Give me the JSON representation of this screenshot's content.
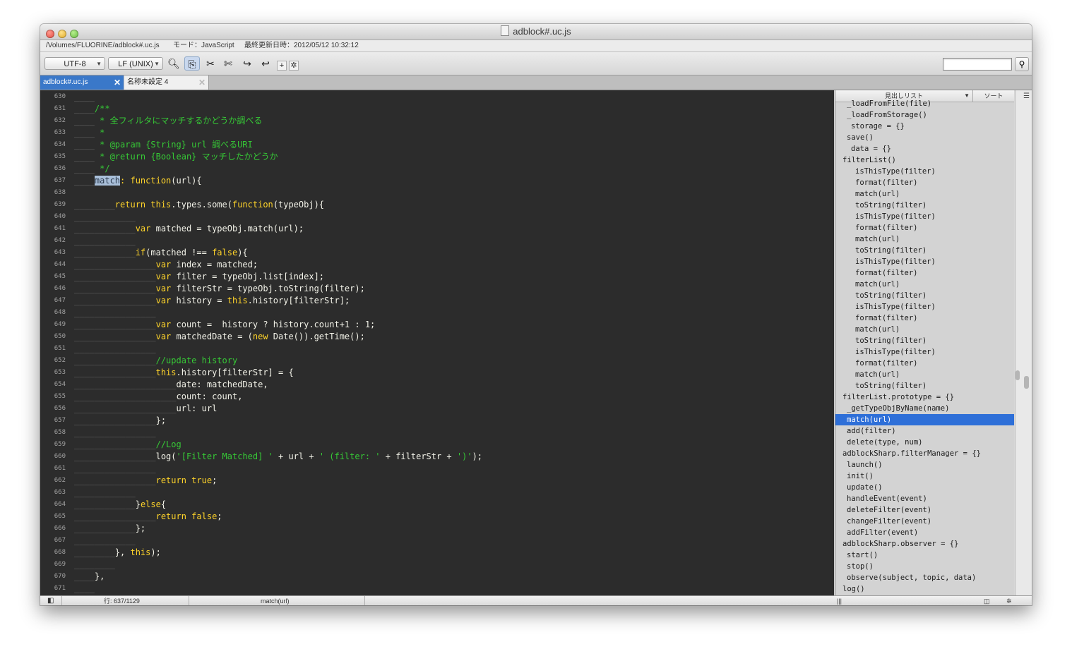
{
  "window": {
    "title": "adblock#.uc.js"
  },
  "info": {
    "path": "/Volumes/FLUORINE/adblock#.uc.js",
    "mode": "モード：JavaScript",
    "modified": "最終更新日時：2012/05/12 10:32:12"
  },
  "toolbar": {
    "encoding": "UTF-8",
    "line_ending": "LF (UNIX)"
  },
  "tabs": [
    {
      "label": "adblock#.uc.js",
      "active": true
    },
    {
      "label": "名称未設定 4",
      "active": false
    }
  ],
  "editor": {
    "lines": [
      {
        "n": "630",
        "i": 1,
        "tokens": []
      },
      {
        "n": "631",
        "i": 1,
        "tokens": [
          [
            "cm",
            "/**"
          ]
        ]
      },
      {
        "n": "632",
        "i": 1,
        "tokens": [
          [
            "cm",
            " * 全フィルタにマッチするかどうか調べる"
          ]
        ]
      },
      {
        "n": "633",
        "i": 1,
        "tokens": [
          [
            "cm",
            " *"
          ]
        ]
      },
      {
        "n": "634",
        "i": 1,
        "tokens": [
          [
            "cm",
            " * @param {String} url 調べるURI"
          ]
        ]
      },
      {
        "n": "635",
        "i": 1,
        "tokens": [
          [
            "cm",
            " * @return {Boolean} マッチしたかどうか"
          ]
        ]
      },
      {
        "n": "636",
        "i": 1,
        "tokens": [
          [
            "cm",
            " */"
          ]
        ]
      },
      {
        "n": "637",
        "i": 1,
        "tokens": [
          [
            "hl",
            "match"
          ],
          [
            "kw",
            ": function"
          ],
          [
            "p",
            "(url){"
          ]
        ]
      },
      {
        "n": "638",
        "i": 0,
        "tokens": []
      },
      {
        "n": "639",
        "i": 2,
        "tokens": [
          [
            "kw",
            "return this"
          ],
          [
            "p",
            ".types.some("
          ],
          [
            "kw",
            "function"
          ],
          [
            "p",
            "(typeObj){"
          ]
        ]
      },
      {
        "n": "640",
        "i": 3,
        "tokens": []
      },
      {
        "n": "641",
        "i": 3,
        "tokens": [
          [
            "kw",
            "var"
          ],
          [
            "p",
            " matched = typeObj.match(url);"
          ]
        ]
      },
      {
        "n": "642",
        "i": 3,
        "tokens": []
      },
      {
        "n": "643",
        "i": 3,
        "tokens": [
          [
            "kw",
            "if"
          ],
          [
            "p",
            "(matched !== "
          ],
          [
            "kw",
            "false"
          ],
          [
            "p",
            "){"
          ]
        ]
      },
      {
        "n": "644",
        "i": 4,
        "tokens": [
          [
            "kw",
            "var"
          ],
          [
            "p",
            " index = matched;"
          ]
        ]
      },
      {
        "n": "645",
        "i": 4,
        "tokens": [
          [
            "kw",
            "var"
          ],
          [
            "p",
            " filter = typeObj.list[index];"
          ]
        ]
      },
      {
        "n": "646",
        "i": 4,
        "tokens": [
          [
            "kw",
            "var"
          ],
          [
            "p",
            " filterStr = typeObj.toString(filter);"
          ]
        ]
      },
      {
        "n": "647",
        "i": 4,
        "tokens": [
          [
            "kw",
            "var"
          ],
          [
            "p",
            " history = "
          ],
          [
            "kw",
            "this"
          ],
          [
            "p",
            ".history[filterStr];"
          ]
        ]
      },
      {
        "n": "648",
        "i": 4,
        "tokens": []
      },
      {
        "n": "649",
        "i": 4,
        "tokens": [
          [
            "kw",
            "var"
          ],
          [
            "p",
            " count =  history ? history.count+1 : 1;"
          ]
        ]
      },
      {
        "n": "650",
        "i": 4,
        "tokens": [
          [
            "kw",
            "var"
          ],
          [
            "p",
            " matchedDate = ("
          ],
          [
            "kw",
            "new"
          ],
          [
            "p",
            " Date()).getTime();"
          ]
        ]
      },
      {
        "n": "651",
        "i": 4,
        "tokens": []
      },
      {
        "n": "652",
        "i": 4,
        "tokens": [
          [
            "cm",
            "//update history"
          ]
        ]
      },
      {
        "n": "653",
        "i": 4,
        "tokens": [
          [
            "kw",
            "this"
          ],
          [
            "p",
            ".history[filterStr] = {"
          ]
        ]
      },
      {
        "n": "654",
        "i": 5,
        "tokens": [
          [
            "p",
            "date: matchedDate,"
          ]
        ]
      },
      {
        "n": "655",
        "i": 5,
        "tokens": [
          [
            "p",
            "count: count,"
          ]
        ]
      },
      {
        "n": "656",
        "i": 5,
        "tokens": [
          [
            "p",
            "url: url"
          ]
        ]
      },
      {
        "n": "657",
        "i": 4,
        "tokens": [
          [
            "p",
            "};"
          ]
        ]
      },
      {
        "n": "658",
        "i": 4,
        "tokens": []
      },
      {
        "n": "659",
        "i": 4,
        "tokens": [
          [
            "cm",
            "//Log"
          ]
        ]
      },
      {
        "n": "660",
        "i": 4,
        "tokens": [
          [
            "p",
            "log("
          ],
          [
            "st",
            "'[Filter Matched] '"
          ],
          [
            "p",
            " + url + "
          ],
          [
            "st",
            "' (filter: '"
          ],
          [
            "p",
            " + filterStr + "
          ],
          [
            "st",
            "')'"
          ],
          [
            "p",
            ");"
          ]
        ]
      },
      {
        "n": "661",
        "i": 4,
        "tokens": []
      },
      {
        "n": "662",
        "i": 4,
        "tokens": [
          [
            "kw",
            "return true"
          ],
          [
            "p",
            ";"
          ]
        ]
      },
      {
        "n": "663",
        "i": 3,
        "tokens": []
      },
      {
        "n": "664",
        "i": 3,
        "tokens": [
          [
            "p",
            "}"
          ],
          [
            "kw",
            "else"
          ],
          [
            "p",
            "{"
          ]
        ]
      },
      {
        "n": "665",
        "i": 4,
        "tokens": [
          [
            "kw",
            "return false"
          ],
          [
            "p",
            ";"
          ]
        ]
      },
      {
        "n": "666",
        "i": 3,
        "tokens": [
          [
            "p",
            "};"
          ]
        ]
      },
      {
        "n": "667",
        "i": 3,
        "tokens": []
      },
      {
        "n": "668",
        "i": 2,
        "tokens": [
          [
            "p",
            "}, "
          ],
          [
            "kw",
            "this"
          ],
          [
            "p",
            ");"
          ]
        ]
      },
      {
        "n": "669",
        "i": 2,
        "tokens": []
      },
      {
        "n": "670",
        "i": 1,
        "tokens": [
          [
            "p",
            "},"
          ]
        ]
      },
      {
        "n": "671",
        "i": 1,
        "tokens": []
      }
    ]
  },
  "outline": {
    "header_label": "見出しリスト",
    "sort_label": "ソート",
    "items": [
      {
        "label": "_loadFromFile(file)",
        "indent": 1
      },
      {
        "label": "_loadFromStorage()",
        "indent": 1
      },
      {
        "label": "storage = {}",
        "indent": 2
      },
      {
        "label": "save()",
        "indent": 1
      },
      {
        "label": "data = {}",
        "indent": 2
      },
      {
        "label": "filterList()",
        "indent": 0
      },
      {
        "label": "isThisType(filter)",
        "indent": 3
      },
      {
        "label": "format(filter)",
        "indent": 3
      },
      {
        "label": "match(url)",
        "indent": 3
      },
      {
        "label": "toString(filter)",
        "indent": 3
      },
      {
        "label": "isThisType(filter)",
        "indent": 3
      },
      {
        "label": "format(filter)",
        "indent": 3
      },
      {
        "label": "match(url)",
        "indent": 3
      },
      {
        "label": "toString(filter)",
        "indent": 3
      },
      {
        "label": "isThisType(filter)",
        "indent": 3
      },
      {
        "label": "format(filter)",
        "indent": 3
      },
      {
        "label": "match(url)",
        "indent": 3
      },
      {
        "label": "toString(filter)",
        "indent": 3
      },
      {
        "label": "isThisType(filter)",
        "indent": 3
      },
      {
        "label": "format(filter)",
        "indent": 3
      },
      {
        "label": "match(url)",
        "indent": 3
      },
      {
        "label": "toString(filter)",
        "indent": 3
      },
      {
        "label": "isThisType(filter)",
        "indent": 3
      },
      {
        "label": "format(filter)",
        "indent": 3
      },
      {
        "label": "match(url)",
        "indent": 3
      },
      {
        "label": "toString(filter)",
        "indent": 3
      },
      {
        "label": "filterList.prototype = {}",
        "indent": 0
      },
      {
        "label": "_getTypeObjByName(name)",
        "indent": 1
      },
      {
        "label": "match(url)",
        "indent": 1,
        "selected": true
      },
      {
        "label": "add(filter)",
        "indent": 1
      },
      {
        "label": "delete(type, num)",
        "indent": 1
      },
      {
        "label": "adblockSharp.filterManager = {}",
        "indent": 0
      },
      {
        "label": "launch()",
        "indent": 1
      },
      {
        "label": "init()",
        "indent": 1
      },
      {
        "label": "update()",
        "indent": 1
      },
      {
        "label": "handleEvent(event)",
        "indent": 1
      },
      {
        "label": "deleteFilter(event)",
        "indent": 1
      },
      {
        "label": "changeFilter(event)",
        "indent": 1
      },
      {
        "label": "addFilter(event)",
        "indent": 1
      },
      {
        "label": "adblockSharp.observer = {}",
        "indent": 0
      },
      {
        "label": "start()",
        "indent": 1
      },
      {
        "label": "stop()",
        "indent": 1
      },
      {
        "label": "observe(subject, topic, data)",
        "indent": 1
      },
      {
        "label": "log()",
        "indent": 0
      }
    ]
  },
  "status": {
    "line": "行: 637/1129",
    "symbol": "match(url)"
  },
  "colors": {
    "editor_bg": "#2c2c2c",
    "keyword": "#ffd42a",
    "comment": "#36c936",
    "selection": "#2e6fd8"
  }
}
